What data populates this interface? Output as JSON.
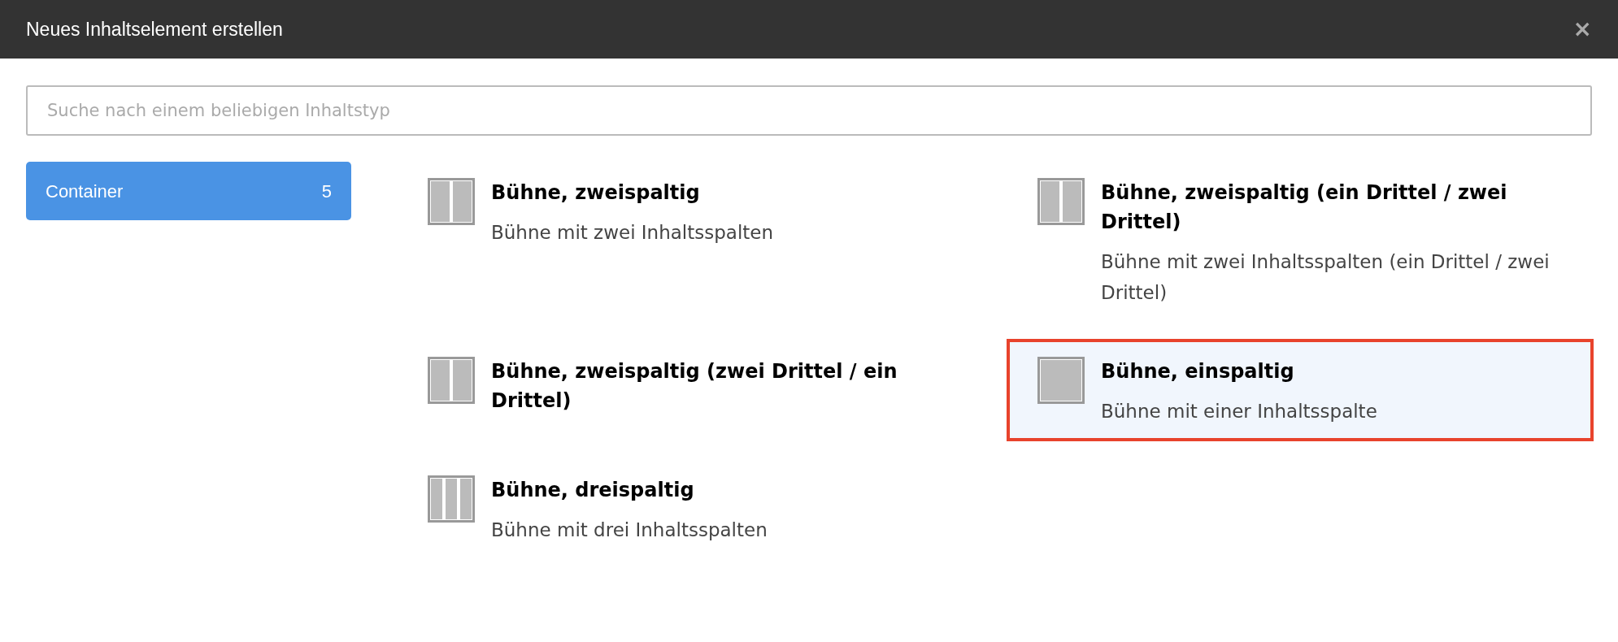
{
  "window": {
    "title": "Neues Inhaltselement erstellen",
    "close": "×"
  },
  "search": {
    "placeholder": "Suche nach einem beliebigen Inhaltstyp"
  },
  "sidebar": {
    "items": [
      {
        "label": "Container",
        "count": "5",
        "selected": true
      }
    ]
  },
  "elements": [
    {
      "title": "Bühne, zweispaltig",
      "description": "Bühne mit zwei Inhaltsspalten",
      "kind": "two",
      "selected": false
    },
    {
      "title": "Bühne, zweispaltig (ein Drittel / zwei Drittel)",
      "description": "Bühne mit zwei Inhaltsspalten (ein Drittel / zwei Drittel)",
      "kind": "two",
      "selected": false
    },
    {
      "title": "Bühne, zweispaltig (zwei Drittel / ein Drittel)",
      "kind": "two",
      "selected": false
    },
    {
      "title": "Bühne, einspaltig",
      "description": "Bühne mit einer Inhaltsspalte",
      "kind": "one",
      "selected": true
    },
    {
      "title": "Bühne, dreispaltig",
      "description": "Bühne mit drei Inhaltsspalten",
      "kind": "three",
      "selected": false
    }
  ]
}
